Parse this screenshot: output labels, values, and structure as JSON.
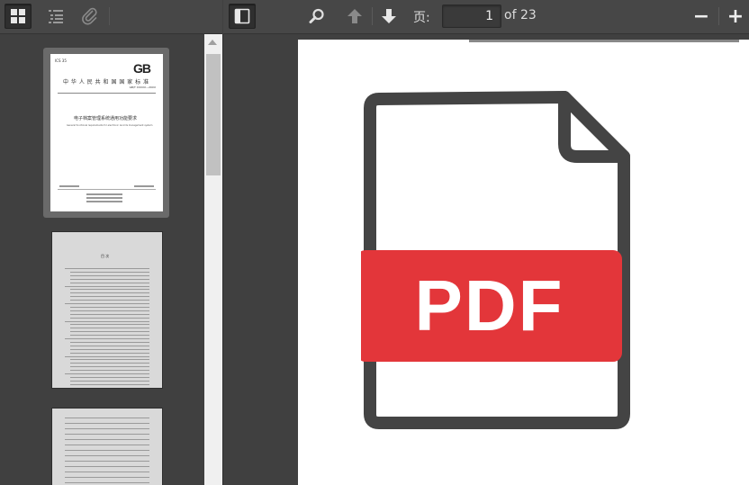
{
  "sidebar_toolbar": {
    "thumbnails_icon": "grid-icon",
    "outline_icon": "list-icon",
    "attachments_icon": "paperclip-icon"
  },
  "toolbar": {
    "sidebar_toggle_icon": "sidebar-toggle-icon",
    "search_icon": "search-icon",
    "prev_icon": "arrow-up-icon",
    "next_icon": "arrow-down-icon",
    "page_label": "页:",
    "page_value": "1",
    "page_of": "of 23",
    "zoom_out": "−",
    "zoom_in": "+"
  },
  "document": {
    "thumb1": {
      "code_small": "ICS 35",
      "logo": "GB",
      "header": "中 华 人 民 共 和 国 国 家 标 准",
      "std_no": "GB/T XXXXX—20XX",
      "title_cn": "电子档案管理系统通用功能要求",
      "title_en": "General functional requirements for electronic records management system"
    },
    "thumb2": {
      "heading": "目 次"
    },
    "placeholder_label": "PDF"
  },
  "colors": {
    "toolbar_bg": "#474747",
    "pdf_red": "#e3363a",
    "icon_dark": "#444444"
  }
}
